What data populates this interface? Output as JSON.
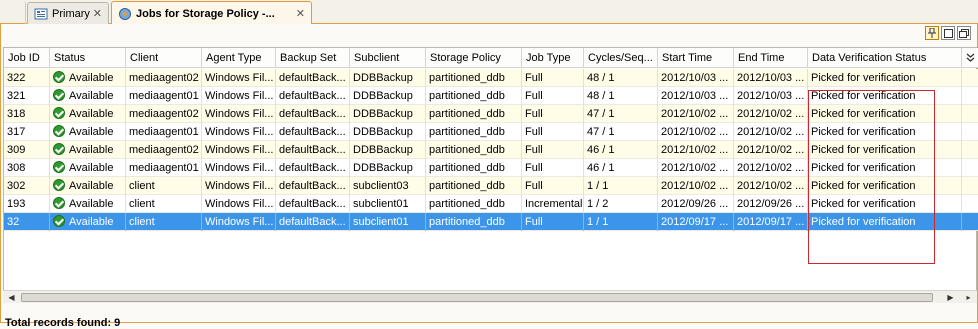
{
  "tabs": [
    {
      "label": "Primary",
      "icon": "primary-icon",
      "close": "✕"
    },
    {
      "label": "Jobs for Storage Policy -...",
      "icon": "storage-policy-icon",
      "close": "✕"
    }
  ],
  "toolbar": {
    "pin": "pin-icon",
    "restore": "restore-icon",
    "maximize": "maximize-icon"
  },
  "columns": [
    "Job ID",
    "Status",
    "Client",
    "Agent Type",
    "Backup Set",
    "Subclient",
    "Storage Policy",
    "Job Type",
    "Cycles/Seq...",
    "Start Time",
    "End Time",
    "Data Verification Status"
  ],
  "rows": [
    [
      "322",
      "Available",
      "mediaagent02",
      "Windows Fil...",
      "defaultBack...",
      "DDBBackup",
      "partitioned_ddb",
      "Full",
      "48 / 1",
      "2012/10/03 ...",
      "2012/10/03 ...",
      "Picked for verification"
    ],
    [
      "321",
      "Available",
      "mediaagent01",
      "Windows Fil...",
      "defaultBack...",
      "DDBBackup",
      "partitioned_ddb",
      "Full",
      "48 / 1",
      "2012/10/03 ...",
      "2012/10/03 ...",
      "Picked for verification"
    ],
    [
      "318",
      "Available",
      "mediaagent02",
      "Windows Fil...",
      "defaultBack...",
      "DDBBackup",
      "partitioned_ddb",
      "Full",
      "47 / 1",
      "2012/10/02 ...",
      "2012/10/02 ...",
      "Picked for verification"
    ],
    [
      "317",
      "Available",
      "mediaagent01",
      "Windows Fil...",
      "defaultBack...",
      "DDBBackup",
      "partitioned_ddb",
      "Full",
      "47 / 1",
      "2012/10/02 ...",
      "2012/10/02 ...",
      "Picked for verification"
    ],
    [
      "309",
      "Available",
      "mediaagent02",
      "Windows Fil...",
      "defaultBack...",
      "DDBBackup",
      "partitioned_ddb",
      "Full",
      "46 / 1",
      "2012/10/02 ...",
      "2012/10/02 ...",
      "Picked for verification"
    ],
    [
      "308",
      "Available",
      "mediaagent01",
      "Windows Fil...",
      "defaultBack...",
      "DDBBackup",
      "partitioned_ddb",
      "Full",
      "46 / 1",
      "2012/10/02 ...",
      "2012/10/02 ...",
      "Picked for verification"
    ],
    [
      "302",
      "Available",
      "client",
      "Windows Fil...",
      "defaultBack...",
      "subclient03",
      "partitioned_ddb",
      "Full",
      "1 / 1",
      "2012/10/02 ...",
      "2012/10/02 ...",
      "Picked for verification"
    ],
    [
      "193",
      "Available",
      "client",
      "Windows Fil...",
      "defaultBack...",
      "subclient01",
      "partitioned_ddb",
      "Incremental",
      "1 / 2",
      "2012/09/26 ...",
      "2012/09/26 ...",
      "Picked for verification"
    ],
    [
      "32",
      "Available",
      "client",
      "Windows Fil...",
      "defaultBack...",
      "subclient01",
      "partitioned_ddb",
      "Full",
      "1 / 1",
      "2012/09/17 ...",
      "2012/09/17 ...",
      "Picked for verification"
    ]
  ],
  "selected_row_index": 8,
  "footer": {
    "total_label": "Total records found: 9"
  },
  "colors": {
    "accent": "#e0a040",
    "selection": "#3d95ea",
    "status_ok": "#2f9a2f",
    "highlight": "#c8282e"
  }
}
